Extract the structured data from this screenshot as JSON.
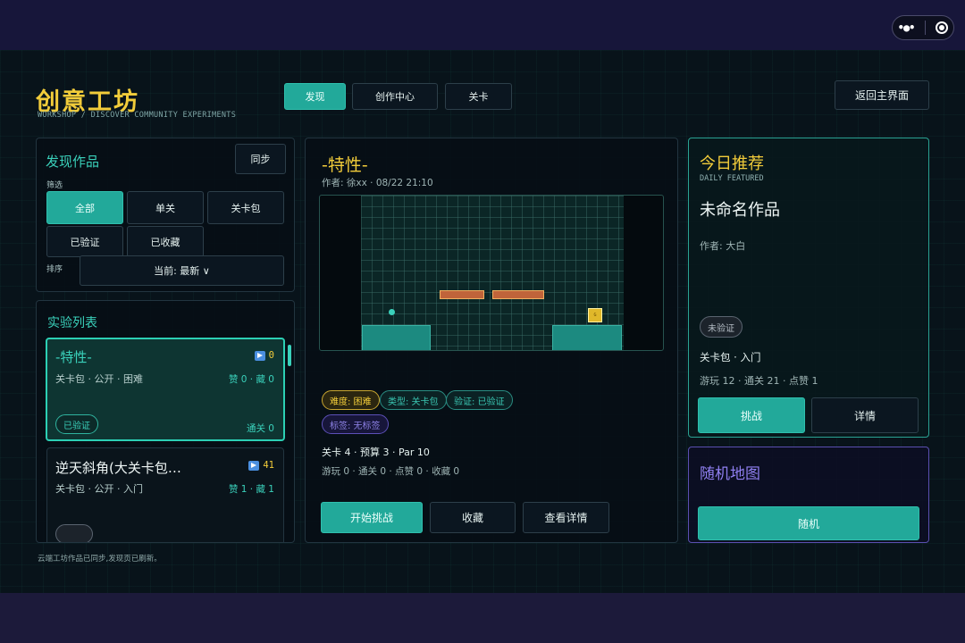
{
  "header": {
    "title": "创意工坊",
    "subtitle": "WORKSHOP / DISCOVER COMMUNITY EXPERIMENTS",
    "tabs": [
      "发现",
      "创作中心",
      "关卡"
    ],
    "back_label": "返回主界面"
  },
  "discover": {
    "title": "发现作品",
    "sync_label": "同步",
    "filter_label": "筛选",
    "filters": [
      "全部",
      "单关",
      "关卡包",
      "已验证",
      "已收藏"
    ],
    "sort_label": "排序",
    "sort_value": "当前: 最新  ∨"
  },
  "list": {
    "title": "实验列表",
    "items": [
      {
        "title": "-特性-",
        "meta": "关卡包 · 公开 · 困难",
        "plays": "0",
        "stats": "赞 0 · 藏 0",
        "badge": "已验证",
        "clears": "通关 0"
      },
      {
        "title": "逆天斜角(大关卡包…",
        "meta": "关卡包 · 公开 · 入门",
        "plays": "41",
        "stats": "赞 1 · 藏 1"
      }
    ]
  },
  "detail": {
    "title": "-特性-",
    "author_line": "作者: 徐xx · 08/22 21:10",
    "tags": [
      "难度: 困难",
      "类型: 关卡包",
      "验证: 已验证",
      "标签: 无标签"
    ],
    "info_line": "关卡 4 · 预算 3 · Par 10",
    "stats_line": "游玩 0 · 通关 0 · 点赞 0 · 收藏 0",
    "buttons": [
      "开始挑战",
      "收藏",
      "查看详情"
    ],
    "goal_glyph": "G"
  },
  "featured": {
    "title": "今日推荐",
    "subtitle": "DAILY FEATURED",
    "name": "未命名作品",
    "author": "作者: 大白",
    "badge": "未验证",
    "category": "关卡包 · 入门",
    "stats": "游玩 12 · 通关 21 · 点赞 1",
    "buttons": [
      "挑战",
      "详情"
    ]
  },
  "random": {
    "title": "随机地图",
    "button": "随机"
  },
  "status": "云端工坊作品已同步,发现页已刷新。",
  "colors": {
    "accent": "#22a99a",
    "gold": "#f2cc3a",
    "violet": "#8f7ff0",
    "background": "#08131a"
  },
  "icons": {
    "capsule_menu": "more-dots-icon",
    "capsule_close": "target-icon",
    "plays": "play-icon"
  }
}
